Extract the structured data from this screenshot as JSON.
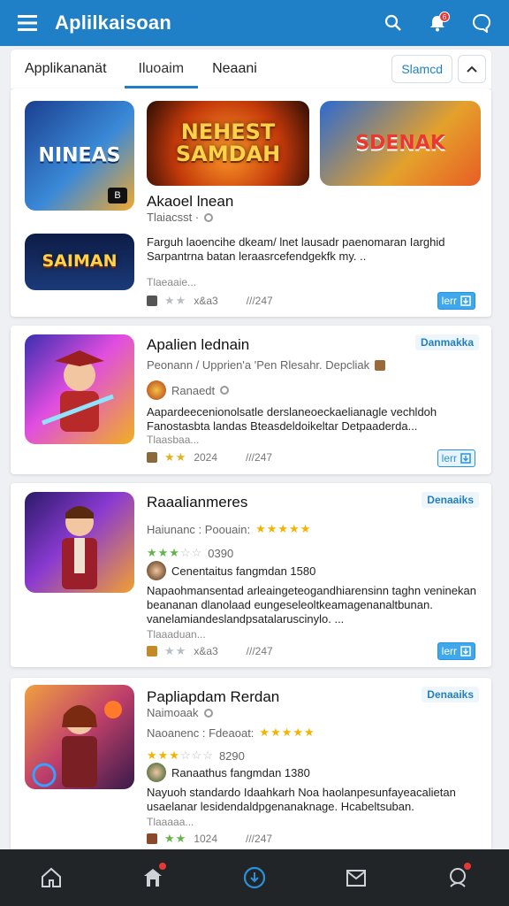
{
  "app": {
    "title": "Aplilkaisoan",
    "notif_count": "6"
  },
  "tabs": [
    {
      "label": "Applikananät"
    },
    {
      "label": "Iluoaim"
    },
    {
      "label": "Neaani"
    }
  ],
  "filter_label": "Slamcd",
  "cards": [
    {
      "thumb1_text": "NINEAS",
      "thumb2_text": "NEHEST SAMDAH",
      "thumb3_text": "SDENAK",
      "thumb4_text": "SAIMAN",
      "title": "Akaoel lnean",
      "meta": "Tlaiacsst ·",
      "desc_line1": "Farguh laoencihe dkeam/ lnet lausadr paenomaran Iarghid",
      "desc_line2": "Sarpantrna batan leraasrcefendgekfk my. ..",
      "small": "Tlaeaaie...",
      "stars_grey": "★★",
      "rating": "x&a3",
      "size": "///247",
      "btn_label": "lerr"
    },
    {
      "title": "Apalien lednain",
      "badge": "Danmakka",
      "meta": "Peonann / Upprien'a 'Pen Rlesahr. Depcliak",
      "dev": "Ranaedt",
      "desc_line1": "Aapardeecenionolsatle derslaneoeckaelianagle vechldoh",
      "desc_line2": "Fanostasbta landas Bteasdeldoikeltar Detpaaderda...",
      "small": "Tlaasbaa...",
      "stars": "★★",
      "rating": "2024",
      "size": "///247",
      "btn_label": "lerr"
    },
    {
      "title": "Raaalianmeres",
      "badge": "Denaaiks",
      "meta": "Haiunanc : Poouain:",
      "stars": "★★★★★",
      "rating_line_stars_green": "★★★",
      "rating_line_stars_grey": "☆☆",
      "rating_line_num": "0390",
      "dev": "Cenentaitus fangmdan 1580",
      "desc_line1": "Napaohmansentad arleaingeteogandhiarensinn taghn veninekan",
      "desc_line2": "beananan dlanolaad eungeseleoltkeamagenanaltbunan.",
      "desc_line3": "vanelamiandeslandpsatalaruscinylo. ...",
      "small": "Tlaaaduan...",
      "stars_grey": "★★",
      "rating": "x&a3",
      "size": "///247",
      "btn_label": "lerr"
    },
    {
      "title": "Papliapdam Rerdan",
      "badge": "Denaaiks",
      "meta": "Naimoaak",
      "meta2": "Naoanenc : Fdeaoat:",
      "stars": "★★★★★",
      "rating_line_stars": "★★★",
      "rating_line_stars_grey": "☆☆☆",
      "rating_line_num": "8290",
      "dev": "Ranaathus fangmdan 1380",
      "desc_line1": "Nayuoh standardo Idaahkarh Noa haolanpesunfayeacalietan",
      "desc_line2": "usaelanar lesidendaldpgenanaknage. Hcabeltsuban.",
      "small": "Tlaaaaa...",
      "stars_mixed": "★★",
      "rating": "1024",
      "size": "///247"
    }
  ],
  "bottom_nav": [
    {
      "label": "home"
    },
    {
      "label": "store"
    },
    {
      "label": "downloads"
    },
    {
      "label": "library"
    },
    {
      "label": "profile"
    }
  ]
}
